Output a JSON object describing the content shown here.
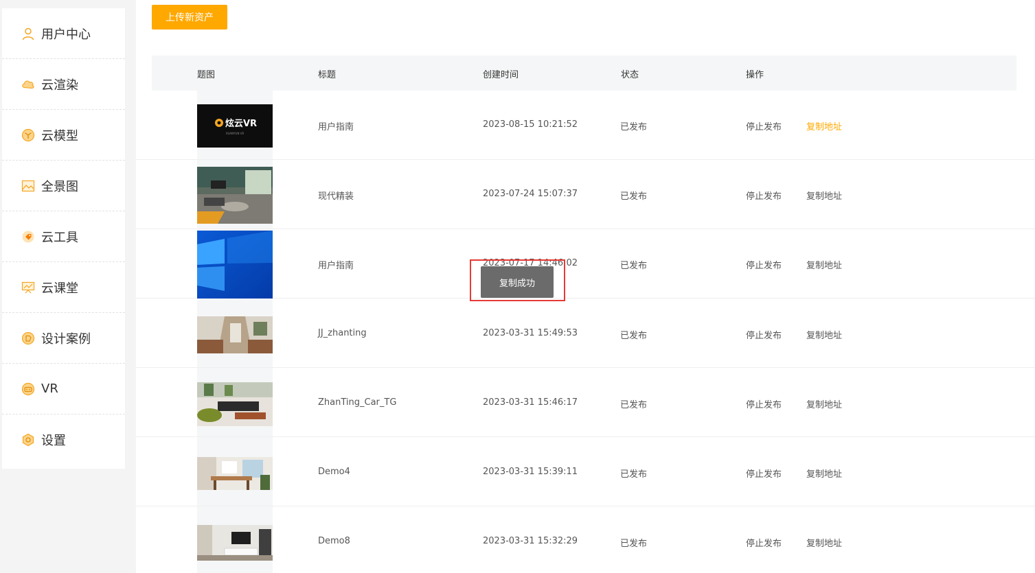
{
  "sidebar": {
    "items": [
      {
        "label": "用户中心",
        "icon": "user-icon"
      },
      {
        "label": "云渲染",
        "icon": "cloud-icon"
      },
      {
        "label": "云模型",
        "icon": "model-icon"
      },
      {
        "label": "全景图",
        "icon": "panorama-icon"
      },
      {
        "label": "云工具",
        "icon": "tool-tag-icon"
      },
      {
        "label": "云课堂",
        "icon": "classroom-icon"
      },
      {
        "label": "设计案例",
        "icon": "design-case-icon"
      },
      {
        "label": "VR",
        "icon": "vr-icon"
      },
      {
        "label": "设置",
        "icon": "settings-icon"
      }
    ]
  },
  "toolbar": {
    "upload_label": "上传新资产"
  },
  "table": {
    "headers": {
      "thumb": "题图",
      "title": "标题",
      "created": "创建时间",
      "status": "状态",
      "actions": "操作"
    },
    "rows": [
      {
        "title": "用户指南",
        "created": "2023-08-15 10:21:52",
        "status": "已发布",
        "stop": "停止发布",
        "copy": "复制地址",
        "thumb_logo": "炫云VR",
        "thumb_sub": "XUANYUN VR"
      },
      {
        "title": "现代精装",
        "created": "2023-07-24 15:07:37",
        "status": "已发布",
        "stop": "停止发布",
        "copy": "复制地址"
      },
      {
        "title": "用户指南",
        "created": "2023-07-17 14:46:02",
        "status": "已发布",
        "stop": "停止发布",
        "copy": "复制地址"
      },
      {
        "title": "JJ_zhanting",
        "created": "2023-03-31 15:49:53",
        "status": "已发布",
        "stop": "停止发布",
        "copy": "复制地址"
      },
      {
        "title": "ZhanTing_Car_TG",
        "created": "2023-03-31 15:46:17",
        "status": "已发布",
        "stop": "停止发布",
        "copy": "复制地址"
      },
      {
        "title": "Demo4",
        "created": "2023-03-31 15:39:11",
        "status": "已发布",
        "stop": "停止发布",
        "copy": "复制地址"
      },
      {
        "title": "Demo8",
        "created": "2023-03-31 15:32:29",
        "status": "已发布",
        "stop": "停止发布",
        "copy": "复制地址"
      }
    ]
  },
  "toast": {
    "message": "复制成功"
  },
  "colors": {
    "accent": "#ffa800",
    "highlight": "#e53935"
  }
}
